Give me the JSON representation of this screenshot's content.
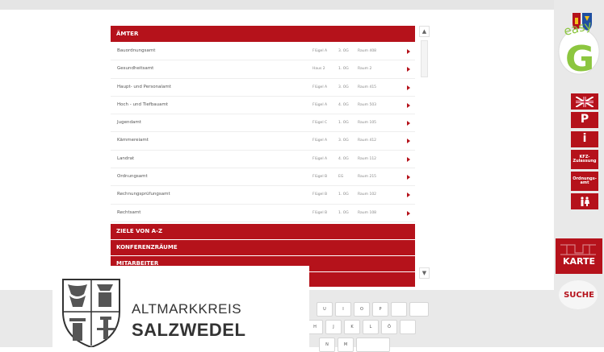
{
  "sections": {
    "aemter": "ÄMTER",
    "ziele": "ZIELE VON A-Z",
    "konferenz": "KONFERENZRÄUME",
    "mitarbeiter": "MITARBEITER"
  },
  "rows": [
    {
      "name": "Bauordnungsamt",
      "wing": "Flügel A",
      "floor": "3. OG",
      "room": "Raum 408"
    },
    {
      "name": "Gesundheitsamt",
      "wing": "Haus 2",
      "floor": "1. OG",
      "room": "Raum 2"
    },
    {
      "name": "Haupt- und Personalamt",
      "wing": "Flügel A",
      "floor": "3. OG",
      "room": "Raum 415"
    },
    {
      "name": "Hoch - und Tiefbauamt",
      "wing": "Flügel A",
      "floor": "4. OG",
      "room": "Raum 503"
    },
    {
      "name": "Jugendamt",
      "wing": "Flügel C",
      "floor": "1. OG",
      "room": "Raum 105"
    },
    {
      "name": "Kämmereiamt",
      "wing": "Flügel A",
      "floor": "3. OG",
      "room": "Raum 412"
    },
    {
      "name": "Landrat",
      "wing": "Flügel A",
      "floor": "4. OG",
      "room": "Raum 112"
    },
    {
      "name": "Ordnungsamt",
      "wing": "Flügel B",
      "floor": "EG",
      "room": "Raum 215"
    },
    {
      "name": "Rechnungsprüfungsamt",
      "wing": "Flügel B",
      "floor": "1. OG",
      "room": "Raum 102"
    },
    {
      "name": "Rechtsamt",
      "wing": "Flügel B",
      "floor": "1. OG",
      "room": "Raum 108"
    }
  ],
  "sidebar": {
    "easy": "easy",
    "g": "G",
    "parking": "P",
    "info": "i",
    "kfz": "KFZ-Zulassung",
    "ordnung": "Ordnungs-amt",
    "karte": "KARTE",
    "suche": "SUCHE"
  },
  "keyboard": {
    "row1": [
      "U",
      "I",
      "O",
      "P"
    ],
    "row2": [
      "H",
      "J",
      "K",
      "L",
      "Ö"
    ],
    "row3": [
      "N",
      "M"
    ]
  },
  "logo": {
    "line1": "ALTMARKKREIS",
    "line2": "SALZWEDEL"
  },
  "scroll": {
    "up": "▲",
    "down": "▼"
  },
  "colors": {
    "brand_red": "#b5121b",
    "easy_green": "#8cc63f"
  }
}
